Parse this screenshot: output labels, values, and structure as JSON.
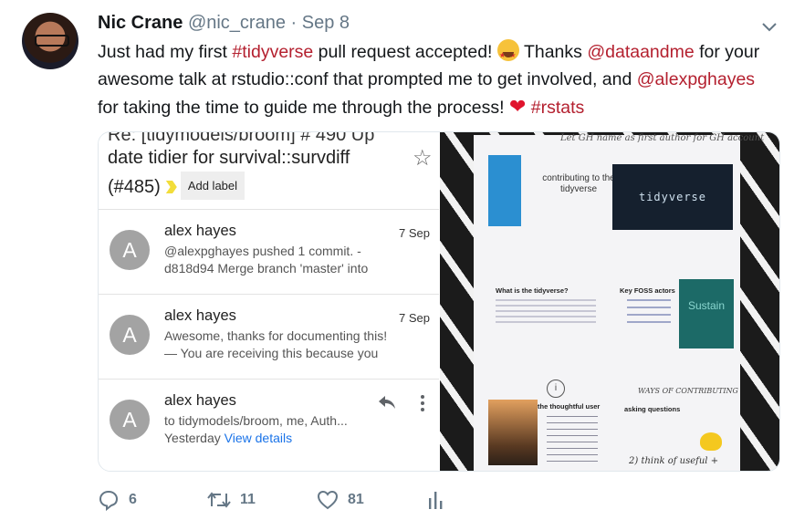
{
  "tweet": {
    "author_name": "Nic Crane",
    "handle": "@nic_crane",
    "separator": "·",
    "date": "Sep 8",
    "text": {
      "t1": "Just had my first ",
      "tag_tidyverse": "#tidyverse",
      "t2": " pull request accepted! ",
      "t3": " Thanks ",
      "mention_dataandme": "@dataandme",
      "t4": " for your awesome talk at rstudio::conf that prompted me to get involved, and ",
      "mention_alexpghayes": "@alexpghayes",
      "t5": " for taking the time to guide me through the process! ",
      "heart": "❤",
      "t6": " ",
      "tag_rstats": "#rstats"
    },
    "colors": {
      "link": "#b4202f",
      "secondary": "#657786"
    }
  },
  "screenshot": {
    "cut_title": "Re: [tidymodels/broom] # 490 Up",
    "issue_title": "date tidier for survival::survdiff",
    "issue_number": "(#485)",
    "label_button": "Add label",
    "emails": [
      {
        "avatar_letter": "A",
        "sender": "alex hayes",
        "date": "7 Sep",
        "line1": "@alexpghayes pushed 1 commit. -",
        "line2": "d818d94 Merge branch 'master' into"
      },
      {
        "avatar_letter": "A",
        "sender": "alex hayes",
        "date": "7 Sep",
        "line1": "Awesome, thanks for documenting this!",
        "line2": "— You are receiving this because you"
      },
      {
        "avatar_letter": "A",
        "sender": "alex hayes",
        "line1": "to tidymodels/broom, me, Auth...",
        "line2_prefix": "Yesterday ",
        "line2_link": "View details"
      }
    ]
  },
  "photo": {
    "top_note": "Let GH name as first author for GH account",
    "contrib_title": "contributing to the tidyverse",
    "tidyverse_card": "tidyverse",
    "what_heading": "What is the tidyverse?",
    "foss_heading": "Key FOSS actors",
    "sustain_card": "Sustain",
    "circle_i": "i",
    "thoughtful": "the thoughtful user",
    "ways": "WAYS OF CONTRIBUTING",
    "asking": "asking questions",
    "bottom_note": "2) think of useful +"
  },
  "actions": {
    "replies": "6",
    "retweets": "11",
    "likes": "81"
  }
}
